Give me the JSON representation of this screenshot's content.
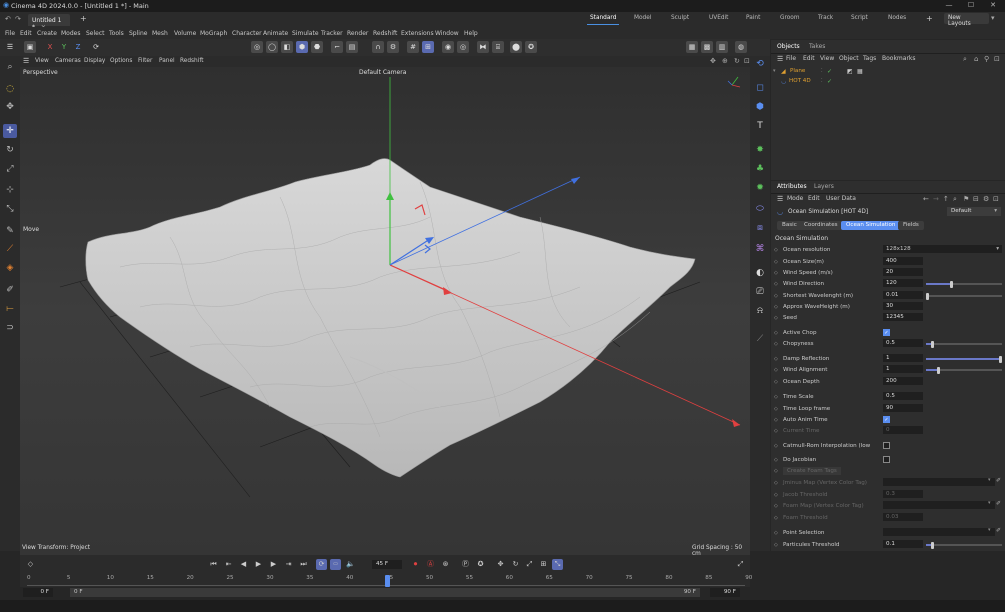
{
  "title_bar": {
    "title": "Cinema 4D 2024.0.0 - [Untitled 1 *] - Main"
  },
  "document_tab": {
    "label": "Untitled 1 *"
  },
  "layouts": [
    {
      "label": "Standard",
      "active": true
    },
    {
      "label": "Model"
    },
    {
      "label": "Sculpt"
    },
    {
      "label": "UVEdit"
    },
    {
      "label": "Paint"
    },
    {
      "label": "Groom"
    },
    {
      "label": "Track"
    },
    {
      "label": "Script"
    },
    {
      "label": "Nodes"
    }
  ],
  "new_layouts_label": "New Layouts",
  "menu": [
    "File",
    "Edit",
    "Create",
    "Modes",
    "Select",
    "Tools",
    "Spline",
    "Mesh",
    "Volume",
    "MoGraph",
    "Character",
    "Animate",
    "Simulate",
    "Tracker",
    "Render",
    "Redshift",
    "Extensions",
    "Window",
    "Help"
  ],
  "viewport": {
    "menu": [
      "View",
      "Cameras",
      "Display",
      "Options",
      "Filter",
      "Panel",
      "Redshift"
    ],
    "label": "Perspective",
    "camera": "Default Camera",
    "move_label": "Move",
    "view_transform": "View Transform: Project",
    "grid_spacing": "Grid Spacing : 50 cm"
  },
  "objects_panel": {
    "tabs": [
      {
        "label": "Objects",
        "active": true
      },
      {
        "label": "Takes"
      }
    ],
    "menu": [
      "File",
      "Edit",
      "View",
      "Object",
      "Tags",
      "Bookmarks"
    ],
    "items": [
      {
        "name": "Plane",
        "color": "#e0a030"
      },
      {
        "name": "HOT 4D",
        "color": "#e0a030"
      }
    ]
  },
  "attributes_panel": {
    "tabs": [
      {
        "label": "Attributes",
        "active": true
      },
      {
        "label": "Layers"
      }
    ],
    "menu": [
      "Mode",
      "Edit",
      "User Data"
    ],
    "object_title": "Ocean Simulation [HOT 4D]",
    "preset": "Default",
    "section_tabs": [
      {
        "label": "Basic"
      },
      {
        "label": "Coordinates"
      },
      {
        "label": "Ocean Simulation",
        "active": true
      },
      {
        "label": "Fields"
      }
    ],
    "section_title": "Ocean Simulation",
    "params": [
      {
        "label": "Ocean resolution",
        "value": "128x128",
        "type": "dropdown"
      },
      {
        "label": "Ocean Size(m)",
        "value": "400"
      },
      {
        "label": "Wind Speed (m/s)",
        "value": "20"
      },
      {
        "label": "Wind Direction",
        "value": "120",
        "slider": 0.33
      },
      {
        "label": "Shortest Wavelenght (m)",
        "value": "0.01",
        "slider": 0.0
      },
      {
        "label": "Approx WaveHeight (m)",
        "value": "30"
      },
      {
        "label": "Seed",
        "value": "12345"
      },
      {
        "label": "Active Chop",
        "type": "check",
        "checked": true
      },
      {
        "label": "Chopyness",
        "value": "0.5",
        "slider": 0.07
      },
      {
        "label": "Damp Reflection",
        "value": "1",
        "slider": 1.0
      },
      {
        "label": "Wind Alignment",
        "value": "1",
        "slider": 0.15
      },
      {
        "label": "Ocean Depth",
        "value": "200"
      },
      {
        "label": "Time Scale",
        "value": "0.5"
      },
      {
        "label": "Time Loop frame",
        "value": "90"
      },
      {
        "label": "Auto Anim Time",
        "type": "check",
        "checked": true
      },
      {
        "label": "Current Time",
        "value": "0",
        "dim": true
      },
      {
        "label": "Catmull-Rom Interpolation (low rez)",
        "type": "check",
        "checked": false
      },
      {
        "label": "Do Jacobian",
        "type": "check",
        "checked": false
      },
      {
        "label": "Create Foam Tags",
        "type": "button",
        "dim": true
      },
      {
        "label": "Jminus Map (Vertex Color Tag)",
        "dim": true,
        "type": "field"
      },
      {
        "label": "Jacob Threshold",
        "value": "0.3",
        "dim": true
      },
      {
        "label": "Foam Map (Vertex Color Tag)",
        "dim": true,
        "type": "field"
      },
      {
        "label": "Foam Threshold",
        "value": "0.03",
        "dim": true
      },
      {
        "label": "Point Selection",
        "type": "field"
      },
      {
        "label": "Particules Threshold",
        "value": "0.1",
        "slider": 0.07
      }
    ]
  },
  "timeline": {
    "current_frame": "45 F",
    "ruler_ticks": [
      "0",
      "5",
      "10",
      "15",
      "20",
      "25",
      "30",
      "35",
      "40",
      "45",
      "50",
      "55",
      "60",
      "65",
      "70",
      "75",
      "80",
      "85",
      "90"
    ],
    "start_frame": "0 F",
    "start_frame_2": "0 F",
    "end_frame": "90 F",
    "end_frame_2": "90 F"
  },
  "colors": {
    "accent": "#5a8ef0",
    "x_axis": "#e04040",
    "y_axis": "#40c040",
    "z_axis": "#4070e0"
  }
}
